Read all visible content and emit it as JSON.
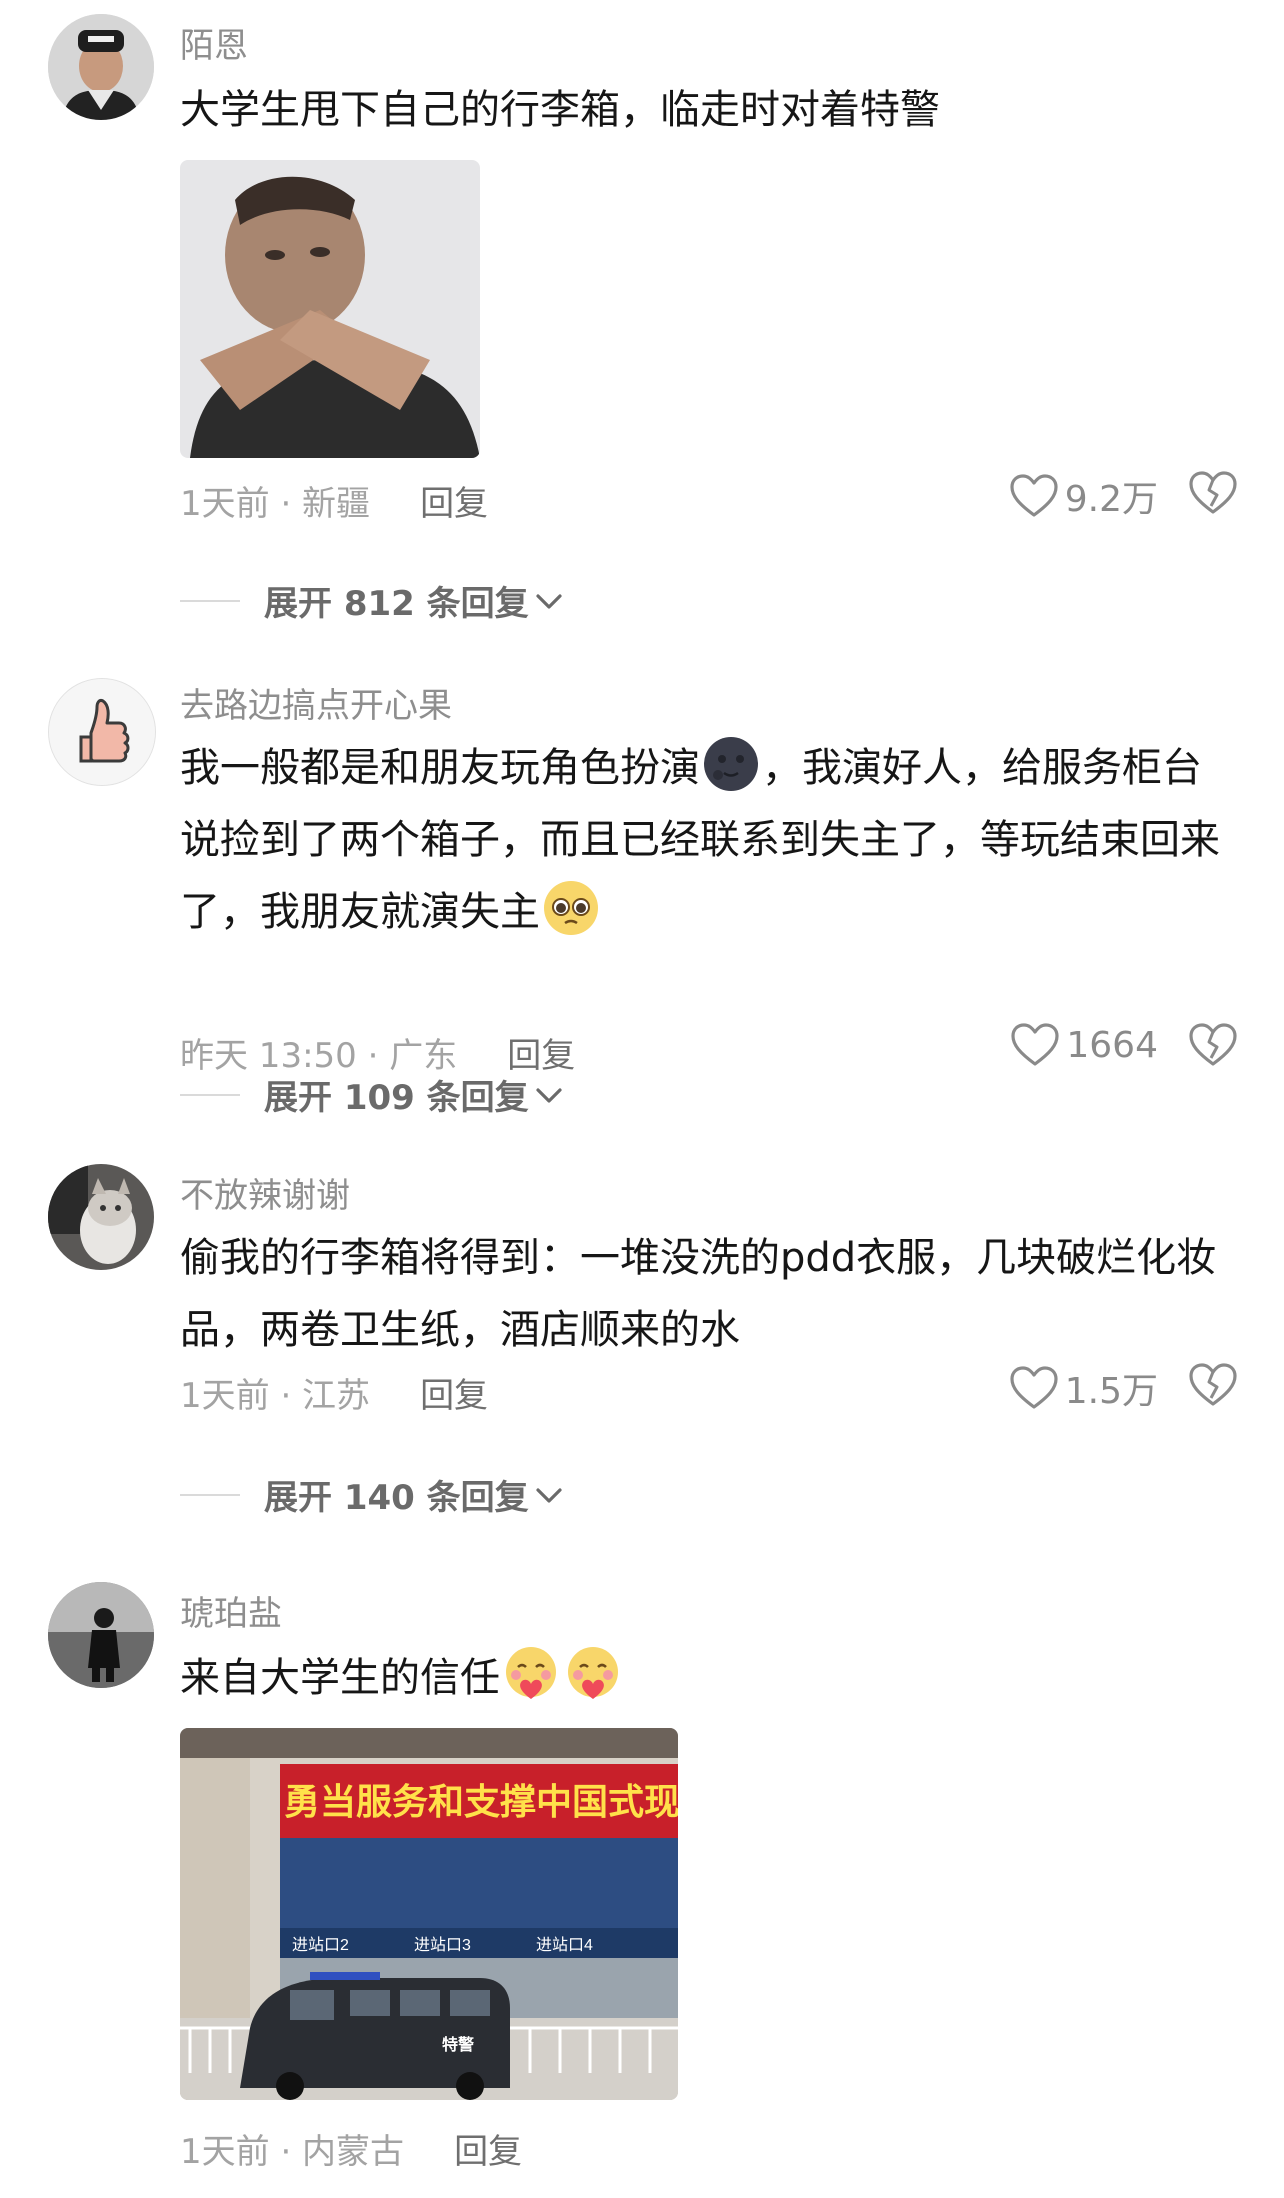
{
  "comments": [
    {
      "username": "陌恩",
      "text": "大学生甩下自己的行李箱，临走时对着特警",
      "time_location": "1天前 · 新疆",
      "reply_label": "回复",
      "likes": "9.2万",
      "expand_label": "展开 812 条回复"
    },
    {
      "username": "去路边搞点开心果",
      "text_parts": [
        "我一般都是和朋友玩角色扮演",
        "，我演好人，给服务柜台说捡到了两个箱子，而且已经联系到失主了，等玩结束回来了，我朋友就演失主"
      ],
      "time_location": "昨天 13:50 · 广东",
      "reply_label": "回复",
      "likes": "1664",
      "expand_label": "展开 109 条回复"
    },
    {
      "username": "不放辣谢谢",
      "text": "偷我的行李箱将得到：一堆没洗的pdd衣服，几块破烂化妆品，两卷卫生纸，酒店顺来的水",
      "time_location": "1天前 · 江苏",
      "reply_label": "回复",
      "likes": "1.5万",
      "expand_label": "展开 140 条回复"
    },
    {
      "username": "琥珀盐",
      "text": "来自大学生的信任",
      "time_location": "1天前 · 内蒙古",
      "reply_label": "回复",
      "banner_text": "勇当服务和支撑中国式现代化建",
      "entrance_labels": [
        "进站口2",
        "进站口3",
        "进站口4"
      ],
      "van_text": "特警"
    }
  ],
  "icons": {
    "like": "heart-outline-icon",
    "dislike": "broken-heart-icon",
    "expand": "chevron-down-icon"
  },
  "colors": {
    "text": "#161616",
    "username": "#8e8e8e",
    "meta": "#a3a3a3"
  }
}
